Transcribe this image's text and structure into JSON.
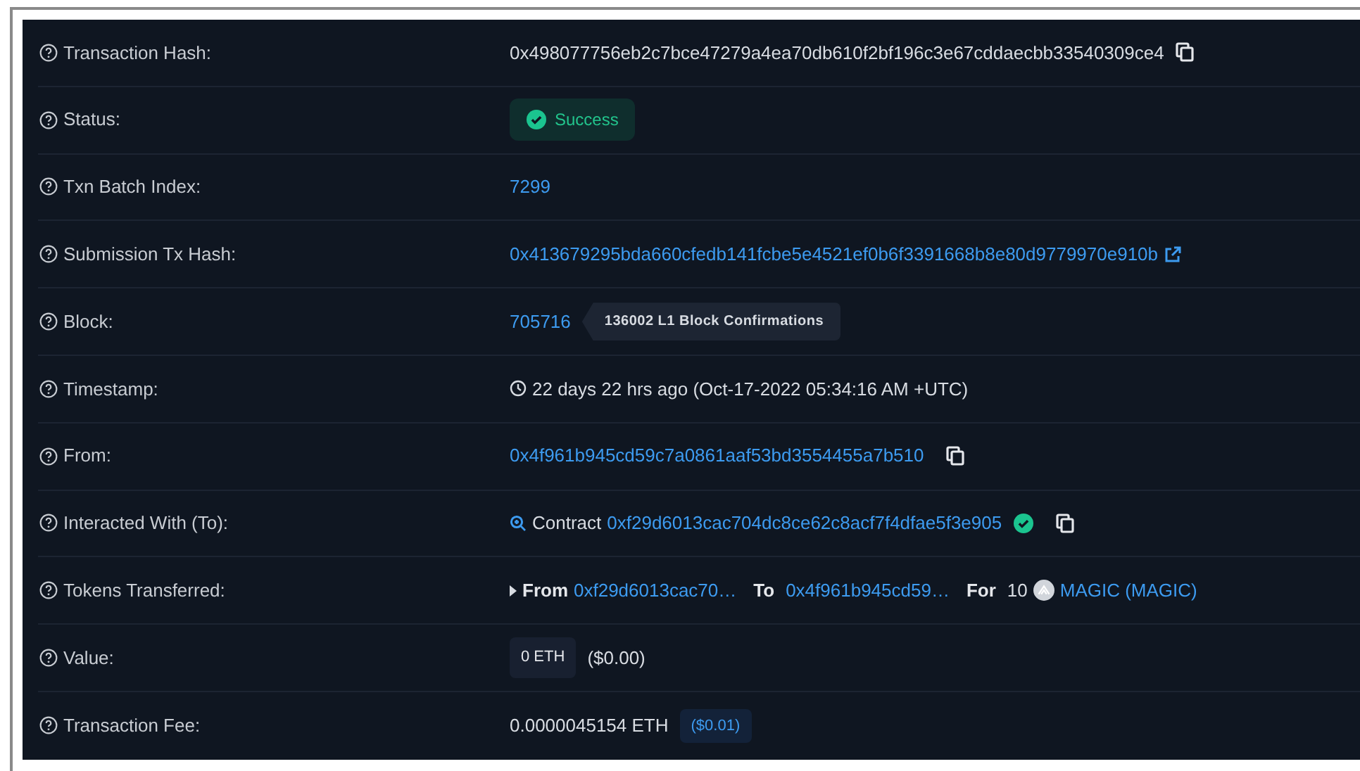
{
  "rows": [
    {
      "label": "Transaction Hash:",
      "kind": "copy-text",
      "value": "0x498077756eb2c7bce47279a4ea70db610f2bf196c3e67cddaecbb33540309ce4"
    },
    {
      "label": "Status:",
      "kind": "status",
      "value": "Success"
    },
    {
      "label": "Txn Batch Index:",
      "kind": "link",
      "value": "7299"
    },
    {
      "label": "Submission Tx Hash:",
      "kind": "external-link",
      "value": "0x413679295bda660cfedb141fcbe5e4521ef0b6f3391668b8e80d9779970e910b"
    },
    {
      "label": "Block:",
      "kind": "block",
      "value": "705716",
      "badge": "136002 L1 Block Confirmations"
    },
    {
      "label": "Timestamp:",
      "kind": "time",
      "value": "22 days 22 hrs ago (Oct-17-2022 05:34:16 AM +UTC)"
    },
    {
      "label": "From:",
      "kind": "copy-link",
      "value": "0x4f961b945cd59c7a0861aaf53bd3554455a7b510"
    },
    {
      "label": "Interacted With (To):",
      "kind": "contract",
      "prefix": "Contract",
      "value": "0xf29d6013cac704dc8ce62c8acf7f4dfae5f3e905"
    },
    {
      "label": "Tokens Transferred:",
      "kind": "tokens",
      "from_label": "From",
      "from": "0xf29d6013cac70…",
      "to_label": "To",
      "to": "0x4f961b945cd59…",
      "for_label": "For",
      "amount": "10",
      "token": "MAGIC (MAGIC)"
    },
    {
      "label": "Value:",
      "kind": "value",
      "value": "0 ETH",
      "usd": "($0.00)"
    },
    {
      "label": "Transaction Fee:",
      "kind": "fee",
      "value": "0.0000045154 ETH",
      "usd": "($0.01)"
    }
  ]
}
